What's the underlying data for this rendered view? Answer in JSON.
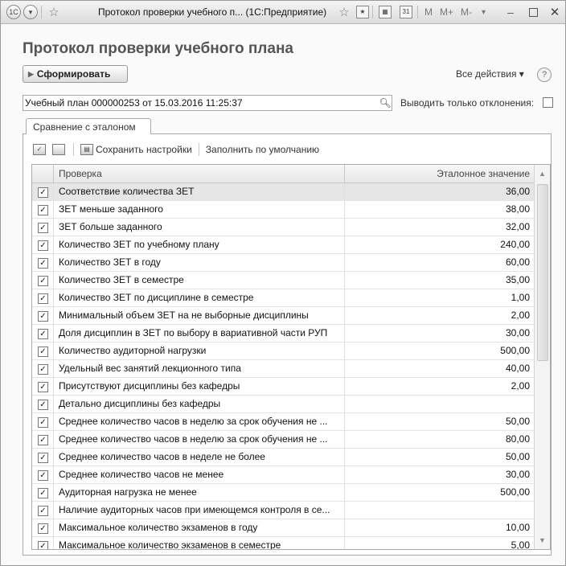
{
  "window": {
    "title": "Протокол проверки учебного п... (1С:Предприятие)",
    "buttons": [
      "M",
      "M+",
      "M-"
    ]
  },
  "form": {
    "title": "Протокол проверки учебного плана",
    "generate_label": "Сформировать",
    "all_actions_label": "Все действия ▾",
    "help_label": "?",
    "plan_value": "Учебный план 000000253 от 15.03.2016 11:25:37",
    "deviation_label": "Выводить только отклонения:",
    "deviation_checked": false
  },
  "tabs": [
    {
      "label": "Сравнение с эталоном",
      "active": true
    }
  ],
  "toolbar": {
    "save_settings_label": "Сохранить настройки",
    "fill_default_label": "Заполнить по умолчанию"
  },
  "table": {
    "columns": [
      "Проверка",
      "Эталонное значение"
    ],
    "rows": [
      {
        "checked": true,
        "name": "Соответствие количества ЗЕТ",
        "value": "36,00",
        "selected": true
      },
      {
        "checked": true,
        "name": "ЗЕТ меньше заданного",
        "value": "38,00"
      },
      {
        "checked": true,
        "name": "ЗЕТ больше заданного",
        "value": "32,00"
      },
      {
        "checked": true,
        "name": "Количество ЗЕТ по учебному плану",
        "value": "240,00"
      },
      {
        "checked": true,
        "name": "Количество ЗЕТ в году",
        "value": "60,00"
      },
      {
        "checked": true,
        "name": "Количество ЗЕТ в семестре",
        "value": "35,00"
      },
      {
        "checked": true,
        "name": "Количество ЗЕТ по дисциплине в семестре",
        "value": "1,00"
      },
      {
        "checked": true,
        "name": "Минимальный объем ЗЕТ на не выборные дисциплины",
        "value": "2,00"
      },
      {
        "checked": true,
        "name": "Доля дисциплин в ЗЕТ по выбору в вариативной части РУП",
        "value": "30,00"
      },
      {
        "checked": true,
        "name": "Количество аудиторной нагрузки",
        "value": "500,00"
      },
      {
        "checked": true,
        "name": "Удельный вес занятий лекционного типа",
        "value": "40,00"
      },
      {
        "checked": true,
        "name": "Присутствуют дисциплины без кафедры",
        "value": "2,00"
      },
      {
        "checked": true,
        "name": "Детально дисциплины без кафедры",
        "value": ""
      },
      {
        "checked": true,
        "name": "Среднее количество часов в неделю за срок обучения не ...",
        "value": "50,00"
      },
      {
        "checked": true,
        "name": "Среднее количество часов в неделю за срок обучения не ...",
        "value": "80,00"
      },
      {
        "checked": true,
        "name": "Среднее количество часов в неделе не более",
        "value": "50,00"
      },
      {
        "checked": true,
        "name": "Среднее количество часов не менее",
        "value": "30,00"
      },
      {
        "checked": true,
        "name": "Аудиторная нагрузка не менее",
        "value": "500,00"
      },
      {
        "checked": true,
        "name": "Наличие аудиторных часов при имеющемся контроля в се...",
        "value": ""
      },
      {
        "checked": true,
        "name": "Максимальное количество экзаменов в году",
        "value": "10,00"
      },
      {
        "checked": true,
        "name": "Максимальное количество экзаменов в семестре",
        "value": "5,00"
      }
    ]
  }
}
